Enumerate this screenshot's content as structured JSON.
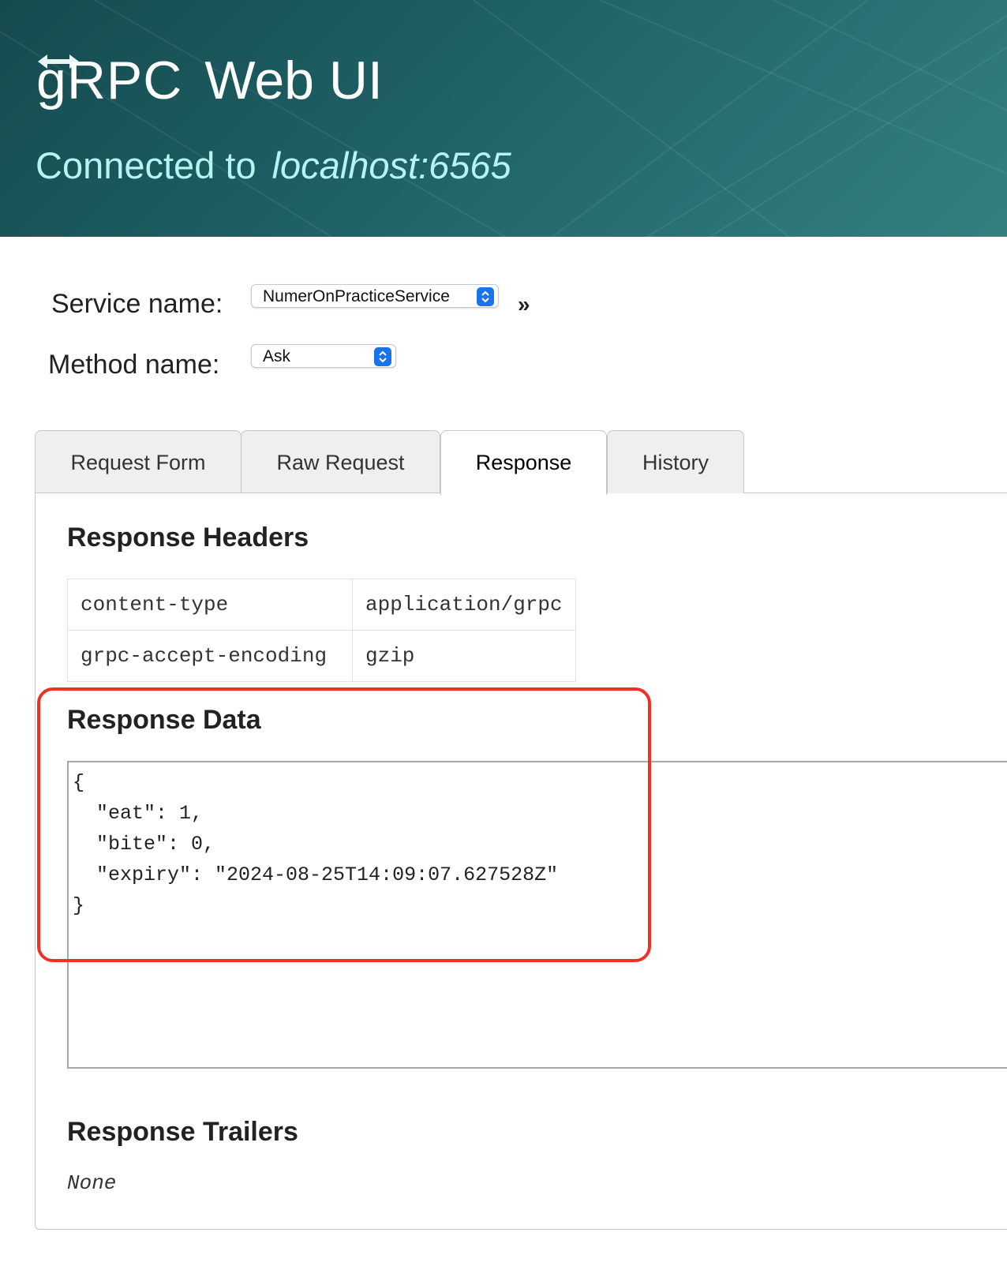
{
  "header": {
    "logo_text": "gRPC",
    "title": "Web UI",
    "connected_label": "Connected to",
    "host": "localhost:6565"
  },
  "form": {
    "service_label": "Service name:",
    "service_value": "NumerOnPracticeService",
    "method_label": "Method name:",
    "method_value": "Ask",
    "invoke_icon": "double-chevron-right-icon"
  },
  "tabs": [
    {
      "label": "Request Form",
      "active": false
    },
    {
      "label": "Raw Request",
      "active": false
    },
    {
      "label": "Response",
      "active": true
    },
    {
      "label": "History",
      "active": false
    }
  ],
  "response": {
    "headers_title": "Response Headers",
    "headers": [
      {
        "name": "content-type",
        "value": "application/grpc"
      },
      {
        "name": "grpc-accept-encoding",
        "value": "gzip"
      }
    ],
    "data_title": "Response Data",
    "data_json": "{\n  \"eat\": 1,\n  \"bite\": 0,\n  \"expiry\": \"2024-08-25T14:09:07.627528Z\"\n}",
    "trailers_title": "Response Trailers",
    "trailers_value": "None"
  },
  "colors": {
    "header_bg": "#1e5f63",
    "subtitle": "#b8f3f3",
    "select_accent": "#1a73e8",
    "highlight": "#ee3124"
  }
}
